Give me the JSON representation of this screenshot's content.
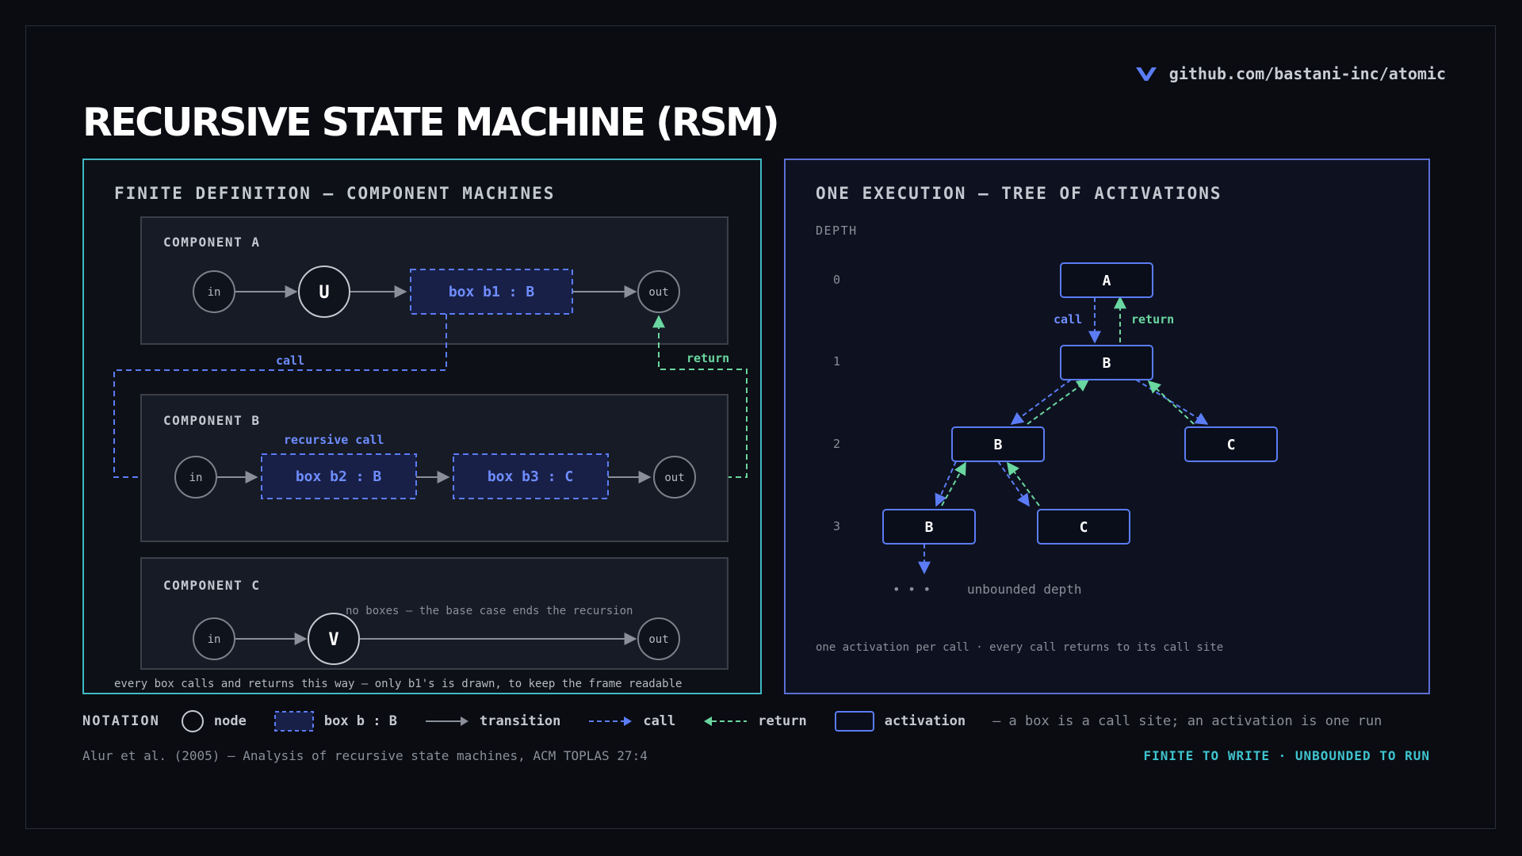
{
  "brand": {
    "repo": "github.com/bastani-inc/atomic",
    "icon": "logo-icon",
    "accent": "#5b7cf5"
  },
  "title": "RECURSIVE STATE MACHINE (RSM)",
  "left_panel": {
    "title": "FINITE DEFINITION — COMPONENT MACHINES",
    "component_a": {
      "label": "COMPONENT A",
      "in": "in",
      "node": "U",
      "box": "box b1 : B",
      "out": "out"
    },
    "component_b": {
      "label": "COMPONENT B",
      "note": "recursive call",
      "in": "in",
      "box1": "box b2 : B",
      "box2": "box b3 : C",
      "out": "out"
    },
    "component_c": {
      "label": "COMPONENT C",
      "note": "no boxes — the base case ends the recursion",
      "in": "in",
      "node": "V",
      "out": "out"
    },
    "call_label": "call",
    "return_label": "return",
    "footnote": "every box calls and returns this way — only b1's is drawn, to keep the frame readable"
  },
  "right_panel": {
    "title": "ONE EXECUTION — TREE OF ACTIVATIONS",
    "depth_label": "DEPTH",
    "depths": [
      "0",
      "1",
      "2",
      "3"
    ],
    "nodes": {
      "root": "A",
      "d1": "B",
      "d2_left": "B",
      "d2_right": "C",
      "d3_left": "B",
      "d3_right": "C"
    },
    "call_label": "call",
    "return_label": "return",
    "unbounded_dots": "•  •  •",
    "unbounded_label": "unbounded depth",
    "footnote": "one activation per call · every call returns to its call site"
  },
  "notation": {
    "label": "NOTATION",
    "node": "node",
    "box": "box b : B",
    "transition": "transition",
    "call": "call",
    "return": "return",
    "activation": "activation",
    "note": "— a box is a call site; an activation is one run"
  },
  "citation": "Alur et al. (2005) — Analysis of recursive state machines, ACM TOPLAS 27:4",
  "tagline": "FINITE TO WRITE · UNBOUNDED TO RUN",
  "colors": {
    "cyan": "#3fb9c5",
    "blue": "#5b7cf5",
    "green": "#6ad6a0",
    "grey": "#8a8f99"
  }
}
